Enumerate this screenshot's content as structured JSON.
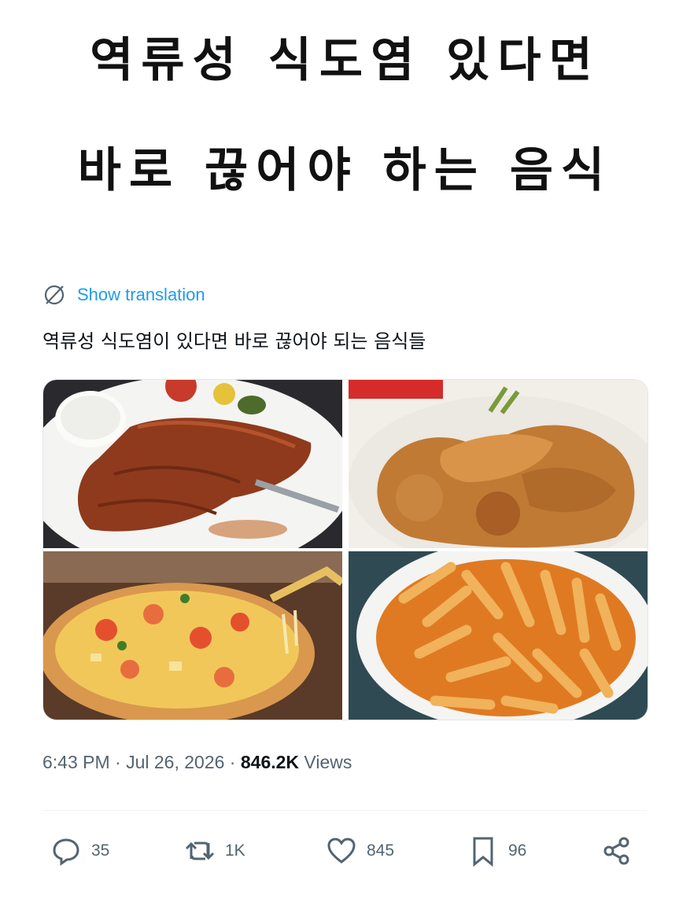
{
  "headline": {
    "line1": "역류성 식도염 있다면",
    "line2": "바로 끊어야 하는 음식"
  },
  "tweet": {
    "translate_label": "Show translation",
    "text": "역류성 식도염이 있다면 바로 끊어야 되는 음식들",
    "time": "6:43 PM · Jul 26, 2026 · ",
    "views_count": "846.2K",
    "views_label": " Views"
  },
  "images": [
    {
      "icon": "pork-cutlet"
    },
    {
      "icon": "fried-chicken"
    },
    {
      "icon": "pizza"
    },
    {
      "icon": "tteokbokki"
    }
  ],
  "actions": {
    "replies": "35",
    "retweets": "1K",
    "likes": "845",
    "bookmarks": "96"
  },
  "colors": {
    "link": "#1d9bf0",
    "muted": "#536471",
    "text": "#0f1419"
  }
}
